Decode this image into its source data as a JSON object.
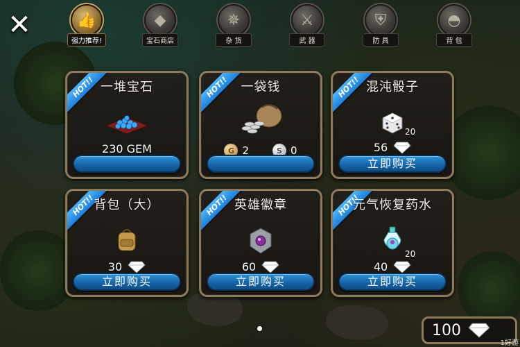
{
  "close_label": "✕",
  "tabs": [
    {
      "label": "强力推荐!",
      "icon": "thumbs-up-icon",
      "glyph": "👍",
      "active": true
    },
    {
      "label": "宝石商店",
      "icon": "gem-icon",
      "glyph": "◆",
      "active": false
    },
    {
      "label": "杂 货",
      "icon": "compass-icon",
      "glyph": "✵",
      "active": false
    },
    {
      "label": "武 器",
      "icon": "sword-icon",
      "glyph": "⚔",
      "active": false
    },
    {
      "label": "防 具",
      "icon": "shield-icon",
      "glyph": "⛨",
      "active": false
    },
    {
      "label": "背 包",
      "icon": "bag-icon",
      "glyph": "◓",
      "active": false
    }
  ],
  "hot_label": "HOT!!",
  "cards": [
    {
      "title": "一堆宝石",
      "price_text": "230 GEM",
      "button": ""
    },
    {
      "title": "一袋钱",
      "gold": "2",
      "silver": "0",
      "button": ""
    },
    {
      "title": "混沌骰子",
      "price": "56",
      "qty": "20",
      "button": "立即购买"
    },
    {
      "title": "背包（大）",
      "price": "30",
      "button": "立即购买"
    },
    {
      "title": "英雄徽章",
      "price": "60",
      "button": "立即购买"
    },
    {
      "title": "元气恢复药水",
      "price": "40",
      "qty": "20",
      "button": "立即购买"
    }
  ],
  "coin_gold_glyph": "G",
  "coin_silver_glyph": "S",
  "currency": {
    "amount": "100"
  },
  "watermark": "1好游",
  "colors": {
    "button_blue": "#1665a8",
    "card_border": "#8d7a5c",
    "hot_blue": "#1d7ed8"
  }
}
